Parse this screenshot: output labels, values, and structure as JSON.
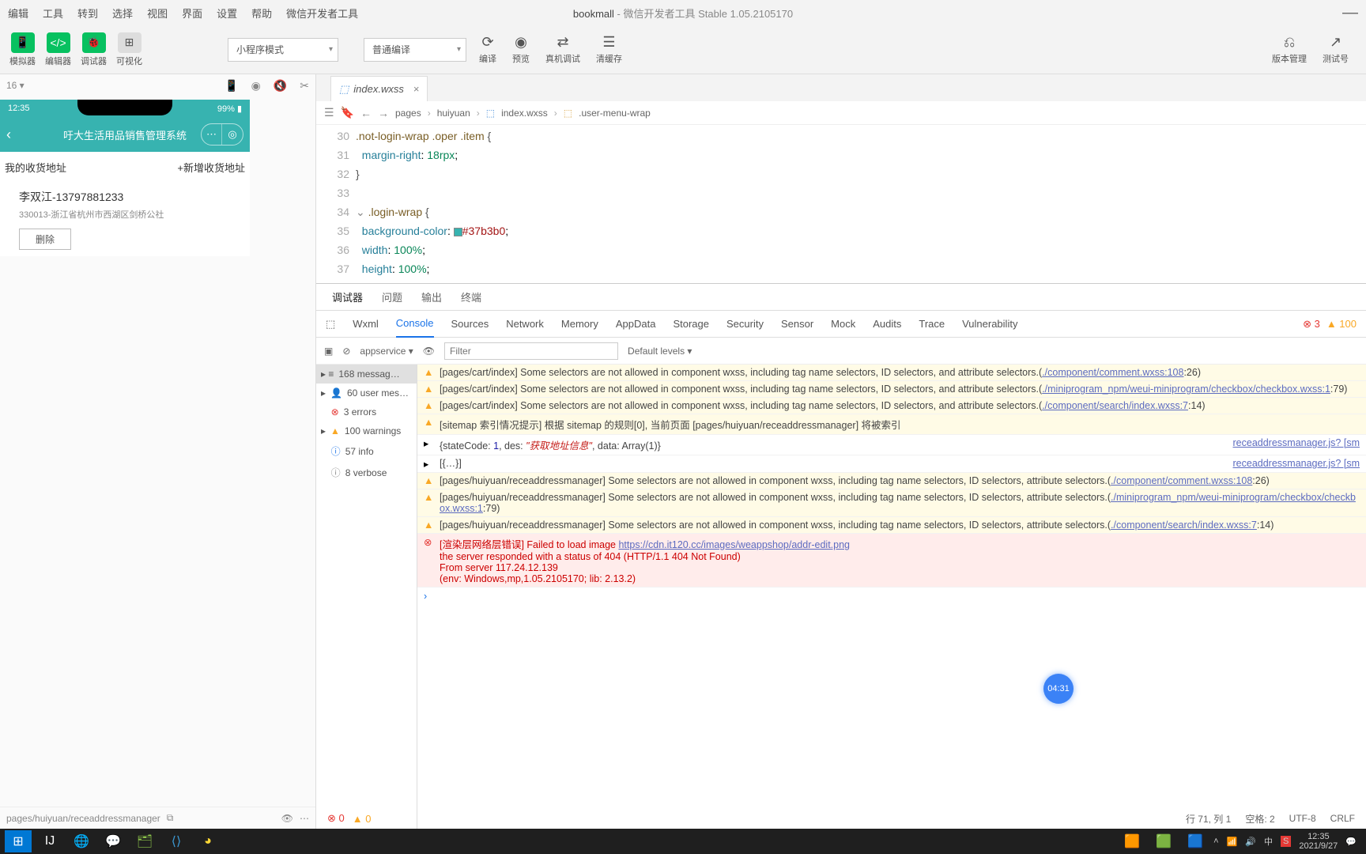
{
  "menu": [
    "编辑",
    "工具",
    "转到",
    "选择",
    "视图",
    "界面",
    "设置",
    "帮助",
    "微信开发者工具"
  ],
  "title": {
    "project": "bookmall",
    "app": "微信开发者工具 Stable 1.05.2105170"
  },
  "toolbar": {
    "groups": [
      "模拟器",
      "编辑器",
      "调试器",
      "可视化"
    ],
    "mode": "小程序模式",
    "compile": "普通编译",
    "actions": {
      "compile": "编译",
      "preview": "预览",
      "remote": "真机调试",
      "clear": "清缓存",
      "version": "版本管理",
      "test": "测试号"
    }
  },
  "left": {
    "zoom": "16 ▾",
    "phone": {
      "time": "12:35",
      "battery": "99%",
      "title": "吁大生活用品销售管理系统",
      "my_addr": "我的收货地址",
      "add_addr": "+新增收货地址",
      "name": "李双江-13797881233",
      "detail": "330013-浙江省杭州市西湖区剑桥公社",
      "delete": "删除"
    },
    "path": "pages/huiyuan/receaddressmanager"
  },
  "editor": {
    "tab": "index.wxss",
    "breadcrumb": [
      "pages",
      "huiyuan",
      "index.wxss",
      ".user-menu-wrap"
    ],
    "lines": {
      "30": ".not-login-wrap .oper .item {",
      "31": "margin-right: 18rpx;",
      "32": "}",
      "33": "",
      "34": ".login-wrap {",
      "35": "background-color: #37b3b0;",
      "36": "width: 100%;",
      "37": "height: 100%;"
    }
  },
  "debugger": {
    "tabs1": [
      "调试器",
      "问题",
      "输出",
      "终端"
    ],
    "tabs2": [
      "Wxml",
      "Console",
      "Sources",
      "Network",
      "Memory",
      "AppData",
      "Storage",
      "Security",
      "Sensor",
      "Mock",
      "Audits",
      "Trace",
      "Vulnerability"
    ],
    "err_count": "3",
    "warn_count": "100",
    "scope": "appservice",
    "filter_placeholder": "Filter",
    "levels": "Default levels ▾",
    "side": {
      "messages": "168 messag…",
      "user": "60 user mes…",
      "errors": "3 errors",
      "warnings": "100 warnings",
      "info": "57 info",
      "verbose": "8 verbose"
    },
    "msgs": [
      {
        "t": "warn",
        "text": "[pages/cart/index] Some selectors are not allowed in component wxss, including tag name selectors, ID selectors, and attribute selectors.(",
        "link": "./component/comment.wxss:108",
        "tail": ":26)"
      },
      {
        "t": "warn",
        "text": "[pages/cart/index] Some selectors are not allowed in component wxss, including tag name selectors, ID selectors, and attribute selectors.(",
        "link": "./miniprogram_npm/weui-miniprogram/checkbox/checkbox.wxss:1",
        "tail": ":79)"
      },
      {
        "t": "warn",
        "text": "[pages/cart/index] Some selectors are not allowed in component wxss, including tag name selectors, ID selectors, and attribute selectors.(",
        "link": "./component/search/index.wxss:7",
        "tail": ":14)"
      },
      {
        "t": "warn",
        "text": "[sitemap 索引情况提示] 根据 sitemap 的规则[0], 当前页面 [pages/huiyuan/receaddressmanager] 将被索引"
      },
      {
        "t": "obj",
        "text": "{stateCode: 1, des: \"获取地址信息\", data: Array(1)}",
        "rlink": "receaddressmanager.js? [sm"
      },
      {
        "t": "obj",
        "text": "[{…}]",
        "rlink": "receaddressmanager.js? [sm"
      },
      {
        "t": "warn",
        "text": "[pages/huiyuan/receaddressmanager] Some selectors are not allowed in component wxss, including tag name selectors, ID selectors, attribute selectors.(",
        "link": "./component/comment.wxss:108",
        "tail": ":26)"
      },
      {
        "t": "warn",
        "text": "[pages/huiyuan/receaddressmanager] Some selectors are not allowed in component wxss, including tag name selectors, ID selectors, attribute selectors.(",
        "link": "./miniprogram_npm/weui-miniprogram/checkbox/checkbox.wxss:1",
        "tail": ":79)"
      },
      {
        "t": "warn",
        "text": "[pages/huiyuan/receaddressmanager] Some selectors are not allowed in component wxss, including tag name selectors, ID selectors, attribute selectors.(",
        "link": "./component/search/index.wxss:7",
        "tail": ":14)"
      },
      {
        "t": "err",
        "lines": [
          "[渲染层网络层错误] Failed to load image https://cdn.it120.cc/images/weappshop/addr-edit.png",
          "the server responded with a status of 404 (HTTP/1.1 404 Not Found)",
          "From server 117.24.12.139",
          "(env: Windows,mp,1.05.2105170; lib: 2.13.2)"
        ]
      }
    ]
  },
  "status": {
    "errs": "0",
    "warns": "0",
    "pos": "行 71, 列 1",
    "spaces": "空格: 2",
    "enc": "UTF-8",
    "eol": "CRLF"
  },
  "timer": "04:31",
  "tray": {
    "time": "12:35",
    "date": "2021/9/27"
  }
}
